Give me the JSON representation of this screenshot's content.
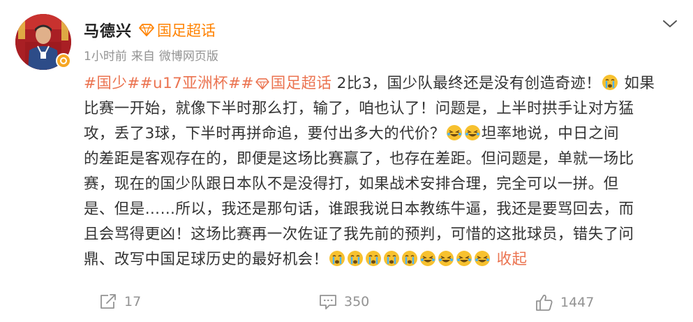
{
  "user": {
    "name": "马德兴",
    "topic": "国足超话",
    "verified_icon": "verified-badge-icon"
  },
  "meta": {
    "time": "1小时前",
    "source_prefix": "来自",
    "source": "微博网页版"
  },
  "post": {
    "line1": {
      "tag1": "#国少#",
      "tag2": "#u17亚洲杯#",
      "tag3_prefix": "#",
      "tag3_label": "国足超话",
      "text": " 2比3，国少队最终还是没有创造奇迹！",
      "text_after": " 如果"
    },
    "line2": "比赛一开始，就像下半时那么打，输了，咱也认了！问题是，上半时拱手让对方猛",
    "line3": {
      "text": "攻，丢了3球，下半时再拼命追，要付出多大的代价？",
      "text_after": "坦率地说，中日之间"
    },
    "line4": "的差距是客观存在的，即便是这场比赛赢了，也存在差距。但问题是，单就一场比",
    "line5": "赛，现在的国少队跟日本队不是没得打，如果战术安排合理，完全可以一拼。但",
    "line6": "是、但是……所以，我还是那句话，谁跟我说日本教练牛逼，我还是要骂回去，而",
    "line7": "且会骂得更凶！这场比赛再一次佐证了我先前的预判，可惜的这批球员，错失了问",
    "line8": {
      "text": "鼎、改写中国足球历史的最好机会！",
      "collapse": "收起"
    }
  },
  "actions": {
    "repost_count": "17",
    "comment_count": "350",
    "like_count": "1447"
  },
  "colors": {
    "accent": "#ff8200",
    "tag": "#eb7350",
    "muted": "#939393",
    "text": "#333333"
  }
}
